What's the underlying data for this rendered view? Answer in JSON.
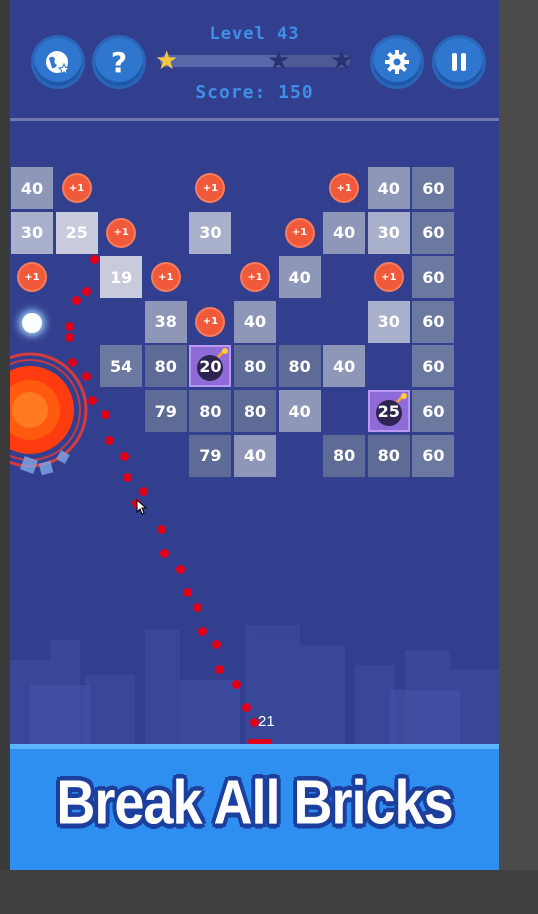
{
  "hud": {
    "level_label": "Level 43",
    "score_label": "Score: 150",
    "progress": 0.65,
    "stars_earned": 1,
    "stars_total": 3
  },
  "buttons": {
    "favorite": "globe-star-icon",
    "help": "?",
    "settings": "gear-icon",
    "pause": "pause-icon"
  },
  "bricks": [
    {
      "row": 0,
      "col": 0,
      "value": "40"
    },
    {
      "row": 0,
      "col": 8,
      "value": "40"
    },
    {
      "row": 0,
      "col": 9,
      "value": "60"
    },
    {
      "row": 1,
      "col": 0,
      "value": "30"
    },
    {
      "row": 1,
      "col": 1,
      "value": "25"
    },
    {
      "row": 1,
      "col": 4,
      "value": "30"
    },
    {
      "row": 1,
      "col": 7,
      "value": "40"
    },
    {
      "row": 1,
      "col": 8,
      "value": "30"
    },
    {
      "row": 1,
      "col": 9,
      "value": "60"
    },
    {
      "row": 2,
      "col": 2,
      "value": "19"
    },
    {
      "row": 2,
      "col": 6,
      "value": "40"
    },
    {
      "row": 2,
      "col": 9,
      "value": "60"
    },
    {
      "row": 3,
      "col": 3,
      "value": "38"
    },
    {
      "row": 3,
      "col": 5,
      "value": "40"
    },
    {
      "row": 3,
      "col": 8,
      "value": "30"
    },
    {
      "row": 3,
      "col": 9,
      "value": "60"
    },
    {
      "row": 4,
      "col": 2,
      "value": "54"
    },
    {
      "row": 4,
      "col": 3,
      "value": "80"
    },
    {
      "row": 4,
      "col": 5,
      "value": "80"
    },
    {
      "row": 4,
      "col": 6,
      "value": "80"
    },
    {
      "row": 4,
      "col": 7,
      "value": "40"
    },
    {
      "row": 4,
      "col": 9,
      "value": "60"
    },
    {
      "row": 5,
      "col": 3,
      "value": "79"
    },
    {
      "row": 5,
      "col": 4,
      "value": "80"
    },
    {
      "row": 5,
      "col": 5,
      "value": "80"
    },
    {
      "row": 5,
      "col": 6,
      "value": "40"
    },
    {
      "row": 5,
      "col": 9,
      "value": "60"
    },
    {
      "row": 6,
      "col": 4,
      "value": "79"
    },
    {
      "row": 6,
      "col": 5,
      "value": "40"
    },
    {
      "row": 6,
      "col": 7,
      "value": "80"
    },
    {
      "row": 6,
      "col": 8,
      "value": "80"
    },
    {
      "row": 6,
      "col": 9,
      "value": "60"
    }
  ],
  "bombs": [
    {
      "row": 4,
      "col": 4,
      "value": "20"
    },
    {
      "row": 5,
      "col": 8,
      "value": "25"
    }
  ],
  "plus_items": [
    {
      "row": 0,
      "col": 1,
      "label": "+1"
    },
    {
      "row": 0,
      "col": 4,
      "label": "+1"
    },
    {
      "row": 0,
      "col": 7,
      "label": "+1"
    },
    {
      "row": 1,
      "col": 2,
      "label": "+1"
    },
    {
      "row": 1,
      "col": 6,
      "label": "+1"
    },
    {
      "row": 2,
      "col": 0,
      "label": "+1"
    },
    {
      "row": 2,
      "col": 3,
      "label": "+1"
    },
    {
      "row": 2,
      "col": 5,
      "label": "+1"
    },
    {
      "row": 2,
      "col": 8,
      "label": "+1"
    },
    {
      "row": 3,
      "col": 4,
      "label": "+1"
    }
  ],
  "ball_count": "21",
  "banner": {
    "text": "Break All Bricks"
  },
  "colors": {
    "background": "#323f8e",
    "brick_low": "#c7cbdc",
    "brick_mid": "#8f97b8",
    "brick_high": "#5d6b96",
    "plus": "#f05a3a",
    "bomb": "#8f6bd8",
    "aim_dots": "#e00018",
    "banner": "#2f8ff0"
  }
}
